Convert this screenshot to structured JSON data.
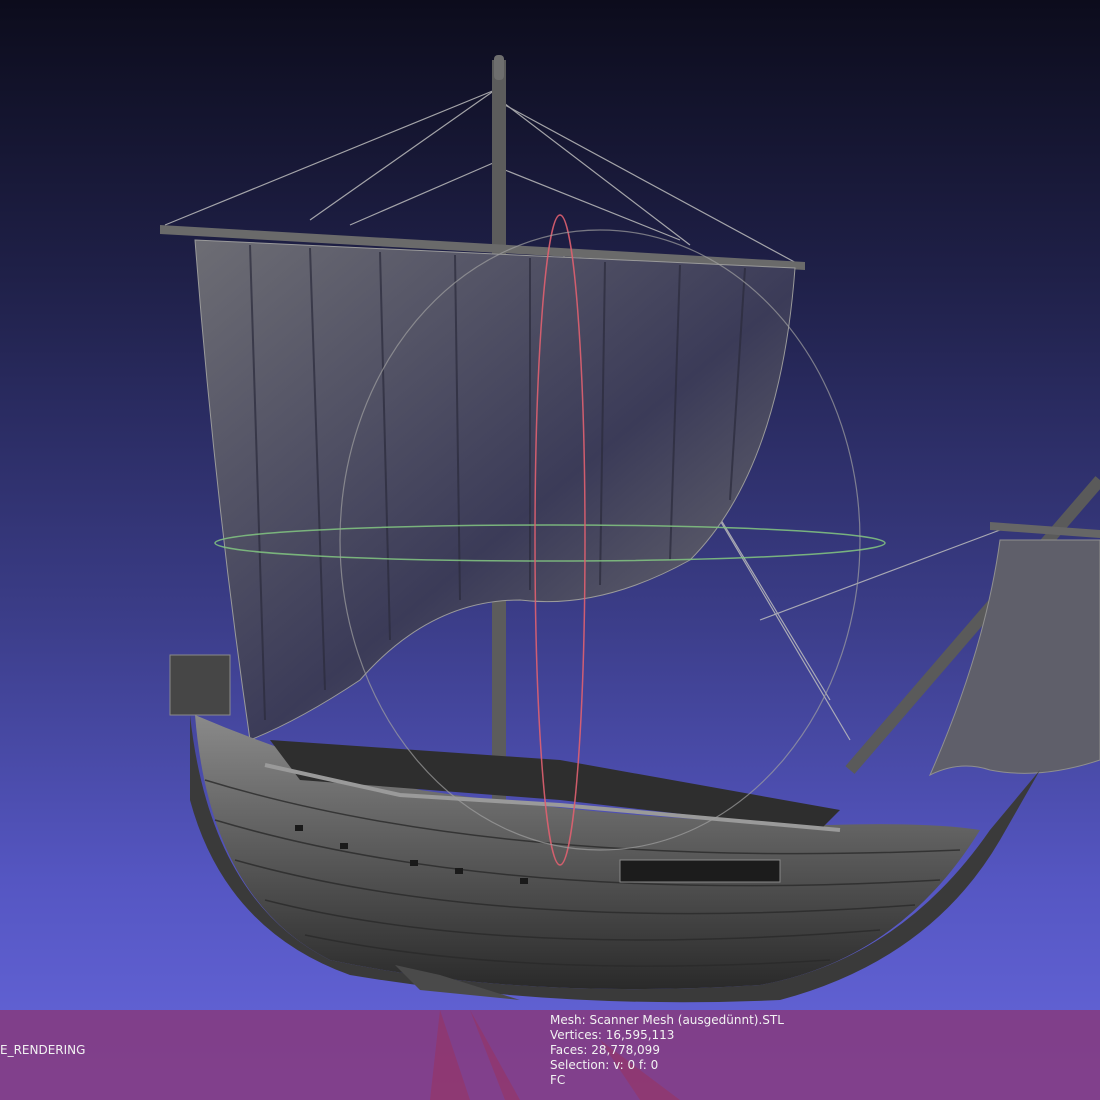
{
  "viewer": {
    "render_mode_label": "E_RENDERING",
    "mesh_info": {
      "mesh_line": "Mesh: Scanner Mesh (ausgedünnt).STL",
      "vertices_line": "Vertices: 16,595,113",
      "faces_line": "Faces: 28,778,099",
      "selection_line": "Selection: v: 0 f: 0",
      "fc_line": "FC"
    }
  },
  "colors": {
    "background_top": "#0c0c1c",
    "background_bottom": "#6767dc",
    "info_bar": "#8c326e",
    "trackball_red": "#e06070",
    "trackball_green": "#80c080",
    "trackball_gray": "#a0a0a0"
  },
  "icons": {
    "trackball": "trackball-gizmo"
  }
}
